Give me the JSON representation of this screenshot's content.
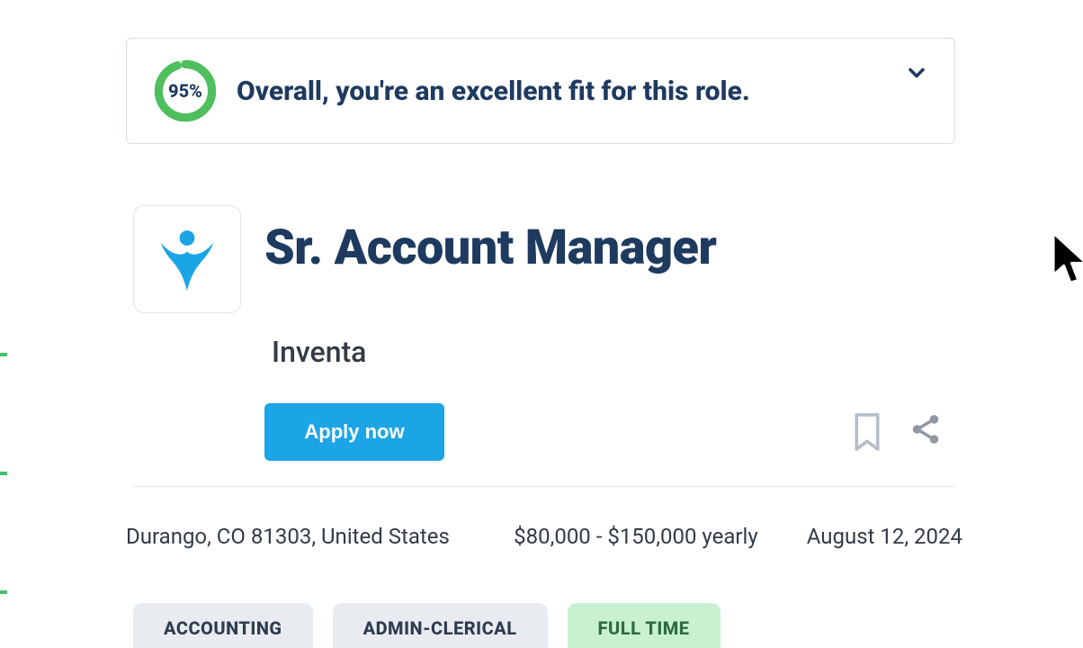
{
  "fit": {
    "percent_label": "95%",
    "percent_value": 95,
    "message": "Overall, you're an excellent fit for this role."
  },
  "job": {
    "title": "Sr. Account Manager",
    "company": "Inventa",
    "apply_label": "Apply now",
    "location": "Durango, CO 81303, United States",
    "salary": "$80,000 - $150,000 yearly",
    "date": "August 12, 2024"
  },
  "tags": [
    {
      "label": "ACCOUNTING",
      "variant": "gray"
    },
    {
      "label": "ADMIN-CLERICAL",
      "variant": "gray"
    },
    {
      "label": "FULL TIME",
      "variant": "green"
    }
  ],
  "icons": {
    "bookmark": "bookmark-icon",
    "share": "share-icon",
    "chevron": "chevron-down-icon",
    "company_logo": "company-logo"
  },
  "colors": {
    "accent_blue": "#1ba5e6",
    "heading_navy": "#1e3a5f",
    "ring_green": "#4fbe5e",
    "tag_gray_bg": "#e8ecf1",
    "tag_green_bg": "#c8f1d2"
  }
}
